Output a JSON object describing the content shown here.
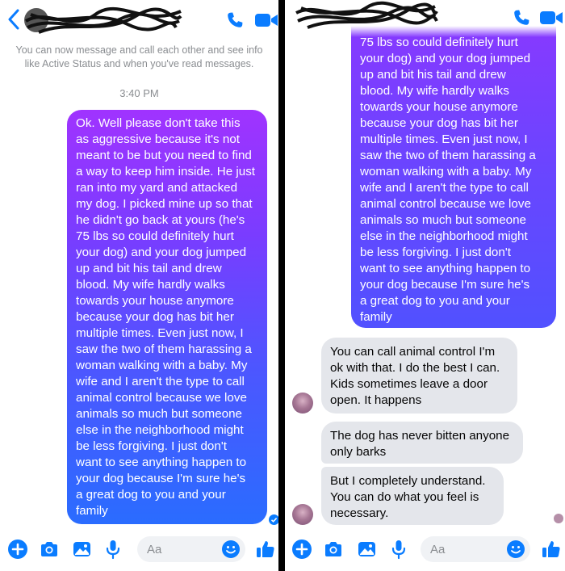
{
  "colors": {
    "messenger_blue": "#0a7cff",
    "incoming_bubble": "#e4e6eb",
    "outgoing_gradient_top": "#a033ff",
    "outgoing_gradient_bottom": "#2a6cff"
  },
  "header": {
    "back_icon": "chevron-left-icon",
    "call_icon": "phone-icon",
    "video_icon": "video-camera-icon"
  },
  "left": {
    "system_note": "You can now message and call each other and see info like Active Status and when you've read messages.",
    "timestamp": "3:40 PM",
    "outgoing_message": "Ok. Well please don't take this\nas aggressive because it's not\nmeant to be but you need to find\na way to keep him inside. He just\nran into my yard and attacked\nmy dog. I picked mine up so that\nhe didn't go back at yours (he's\n75 lbs so could definitely hurt\nyour dog) and your dog jumped\nup and bit his tail and drew\nblood. My wife hardly walks\ntowards your house anymore\nbecause your dog has bit her\nmultiple times. Even just now, I\nsaw the two of them harassing a\nwoman walking with a baby. My\nwife and I aren't the type to call\nanimal control because we love\nanimals so much but someone\nelse in the neighborhood might\nbe less forgiving. I just don't\nwant to see anything happen to\nyour dog because I'm sure he's\na great dog to you and your\nfamily"
  },
  "right": {
    "outgoing_message_continued": "75 lbs so could definitely hurt\nyour dog) and your dog jumped\nup and bit his tail and drew\nblood. My wife hardly walks\ntowards your house anymore\nbecause your dog has bit her\nmultiple times. Even just now, I\nsaw the two of them harassing a\nwoman walking with a baby. My\nwife and I aren't the type to call\nanimal control because we love\nanimals so much but someone\nelse in the neighborhood might\nbe less forgiving. I just don't\nwant to see anything happen to\nyour dog because I'm sure he's\na great dog to you and your\nfamily",
    "incoming_messages": [
      "You can call animal control I'm\nok with that. I do the best I can.\nKids sometimes leave a door\nopen. It happens",
      "The dog has never bitten anyone\nonly barks",
      "But I completely understand.\nYou can do what you feel is\nnecessary."
    ]
  },
  "composer": {
    "placeholder": "Aa",
    "icons": [
      "plus-icon",
      "camera-icon",
      "photo-icon",
      "microphone-icon",
      "emoji-icon",
      "thumbs-up-icon"
    ]
  }
}
